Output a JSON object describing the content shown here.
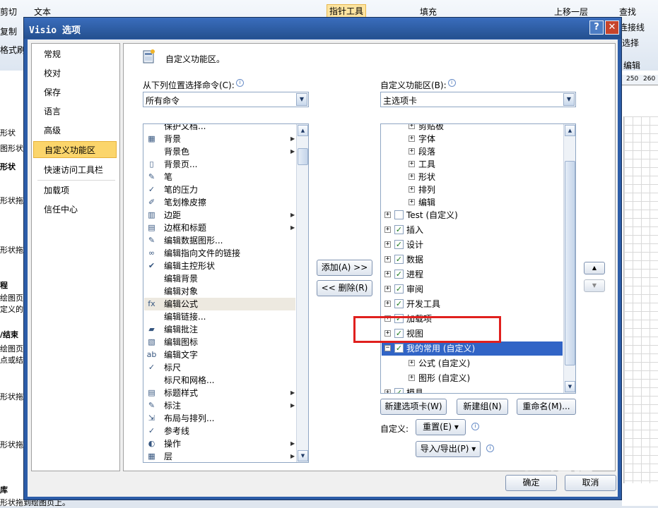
{
  "background_app": {
    "ribbon": [
      "剪切",
      "复制",
      "格式刷",
      "文本",
      "指针工具",
      "填充",
      "上移一层",
      "查找",
      "连接线",
      "选择",
      "编辑",
      "250",
      "260"
    ],
    "left_panel": [
      "形状",
      "图形状",
      "形状",
      "形状拖",
      "形状拖",
      "程",
      "绘图页",
      "定义的",
      "/结束",
      "绘图页",
      "点或结",
      "形状拖",
      "形状拖",
      "库",
      "形状拖到绘图页上。"
    ]
  },
  "dialog": {
    "title": "Visio 选项",
    "help": "?",
    "close": "✕"
  },
  "nav": {
    "items": [
      "常规",
      "校对",
      "保存",
      "语言",
      "高级",
      "自定义功能区",
      "快速访问工具栏",
      "加载项",
      "信任中心"
    ],
    "active_index": 5
  },
  "header": {
    "text": "自定义功能区。"
  },
  "left": {
    "label": "从下列位置选择命令(C):",
    "combo_value": "所有命令",
    "items": [
      {
        "icon": "",
        "text": "保护文档...",
        "sub": false
      },
      {
        "icon": "▦",
        "text": "背景",
        "sub": true
      },
      {
        "icon": "",
        "text": "背景色",
        "sub": true
      },
      {
        "icon": "▯",
        "text": "背景页...",
        "sub": false
      },
      {
        "icon": "✎",
        "text": "笔",
        "sub": false
      },
      {
        "icon": "✓",
        "text": "笔的压力",
        "sub": false
      },
      {
        "icon": "✐",
        "text": "笔划橡皮擦",
        "sub": false
      },
      {
        "icon": "▥",
        "text": "边距",
        "sub": true
      },
      {
        "icon": "▤",
        "text": "边框和标题",
        "sub": true
      },
      {
        "icon": "✎",
        "text": "编辑数据图形...",
        "sub": false
      },
      {
        "icon": "∞",
        "text": "编辑指向文件的链接",
        "sub": false
      },
      {
        "icon": "✔",
        "text": "编辑主控形状",
        "sub": false
      },
      {
        "icon": "",
        "text": "编辑背景",
        "sub": false
      },
      {
        "icon": "",
        "text": "编辑对象",
        "sub": false
      },
      {
        "icon": "fx",
        "text": "编辑公式",
        "sub": false
      },
      {
        "icon": "",
        "text": "编辑链接...",
        "sub": false
      },
      {
        "icon": "▰",
        "text": "编辑批注",
        "sub": false
      },
      {
        "icon": "▧",
        "text": "编辑图标",
        "sub": false
      },
      {
        "icon": "ab",
        "text": "编辑文字",
        "sub": false
      },
      {
        "icon": "✓",
        "text": "标尺",
        "sub": false
      },
      {
        "icon": "",
        "text": "标尺和网格...",
        "sub": false
      },
      {
        "icon": "▤",
        "text": "标题样式",
        "sub": true
      },
      {
        "icon": "✎",
        "text": "标注",
        "sub": true
      },
      {
        "icon": "⇲",
        "text": "布局与排列...",
        "sub": false
      },
      {
        "icon": "✓",
        "text": "参考线",
        "sub": false
      },
      {
        "icon": "◐",
        "text": "操作",
        "sub": true
      },
      {
        "icon": "▦",
        "text": "层",
        "sub": true
      }
    ],
    "highlight_index": 14
  },
  "middle": {
    "add": "添加(A) >>",
    "remove": "<< 删除(R)"
  },
  "right": {
    "label": "自定义功能区(B):",
    "combo_value": "主选项卡",
    "tree": [
      {
        "indent": 2,
        "expander": "+",
        "check": null,
        "text": "剪贴板"
      },
      {
        "indent": 2,
        "expander": "+",
        "check": null,
        "text": "字体"
      },
      {
        "indent": 2,
        "expander": "+",
        "check": null,
        "text": "段落"
      },
      {
        "indent": 2,
        "expander": "+",
        "check": null,
        "text": "工具"
      },
      {
        "indent": 2,
        "expander": "+",
        "check": null,
        "text": "形状"
      },
      {
        "indent": 2,
        "expander": "+",
        "check": null,
        "text": "排列"
      },
      {
        "indent": 2,
        "expander": "+",
        "check": null,
        "text": "编辑"
      },
      {
        "indent": 1,
        "expander": "+",
        "check": false,
        "text": "Test (自定义)"
      },
      {
        "indent": 1,
        "expander": "+",
        "check": true,
        "text": "插入"
      },
      {
        "indent": 1,
        "expander": "+",
        "check": true,
        "text": "设计"
      },
      {
        "indent": 1,
        "expander": "+",
        "check": true,
        "text": "数据"
      },
      {
        "indent": 1,
        "expander": "+",
        "check": true,
        "text": "进程"
      },
      {
        "indent": 1,
        "expander": "+",
        "check": true,
        "text": "审阅"
      },
      {
        "indent": 1,
        "expander": "+",
        "check": true,
        "text": "开发工具"
      },
      {
        "indent": 1,
        "expander": "+",
        "check": true,
        "text": "加载项"
      },
      {
        "indent": 1,
        "expander": "+",
        "check": true,
        "text": "视图"
      },
      {
        "indent": 1,
        "expander": "−",
        "check": true,
        "text": "我的常用 (自定义)"
      },
      {
        "indent": 2,
        "expander": "+",
        "check": null,
        "text": "公式 (自定义)"
      },
      {
        "indent": 2,
        "expander": "+",
        "check": null,
        "text": "图形 (自定义)"
      },
      {
        "indent": 1,
        "expander": "+",
        "check": true,
        "text": "模具"
      }
    ],
    "selected_index": 16,
    "new_tab": "新建选项卡(W)",
    "new_group": "新建组(N)",
    "rename": "重命名(M)...",
    "custom_label": "自定义:",
    "reset": "重置(E) ▾",
    "import_export": "导入/导出(P) ▾"
  },
  "footer": {
    "ok": "确定",
    "cancel": "取消"
  },
  "watermark": "Bai 经验"
}
